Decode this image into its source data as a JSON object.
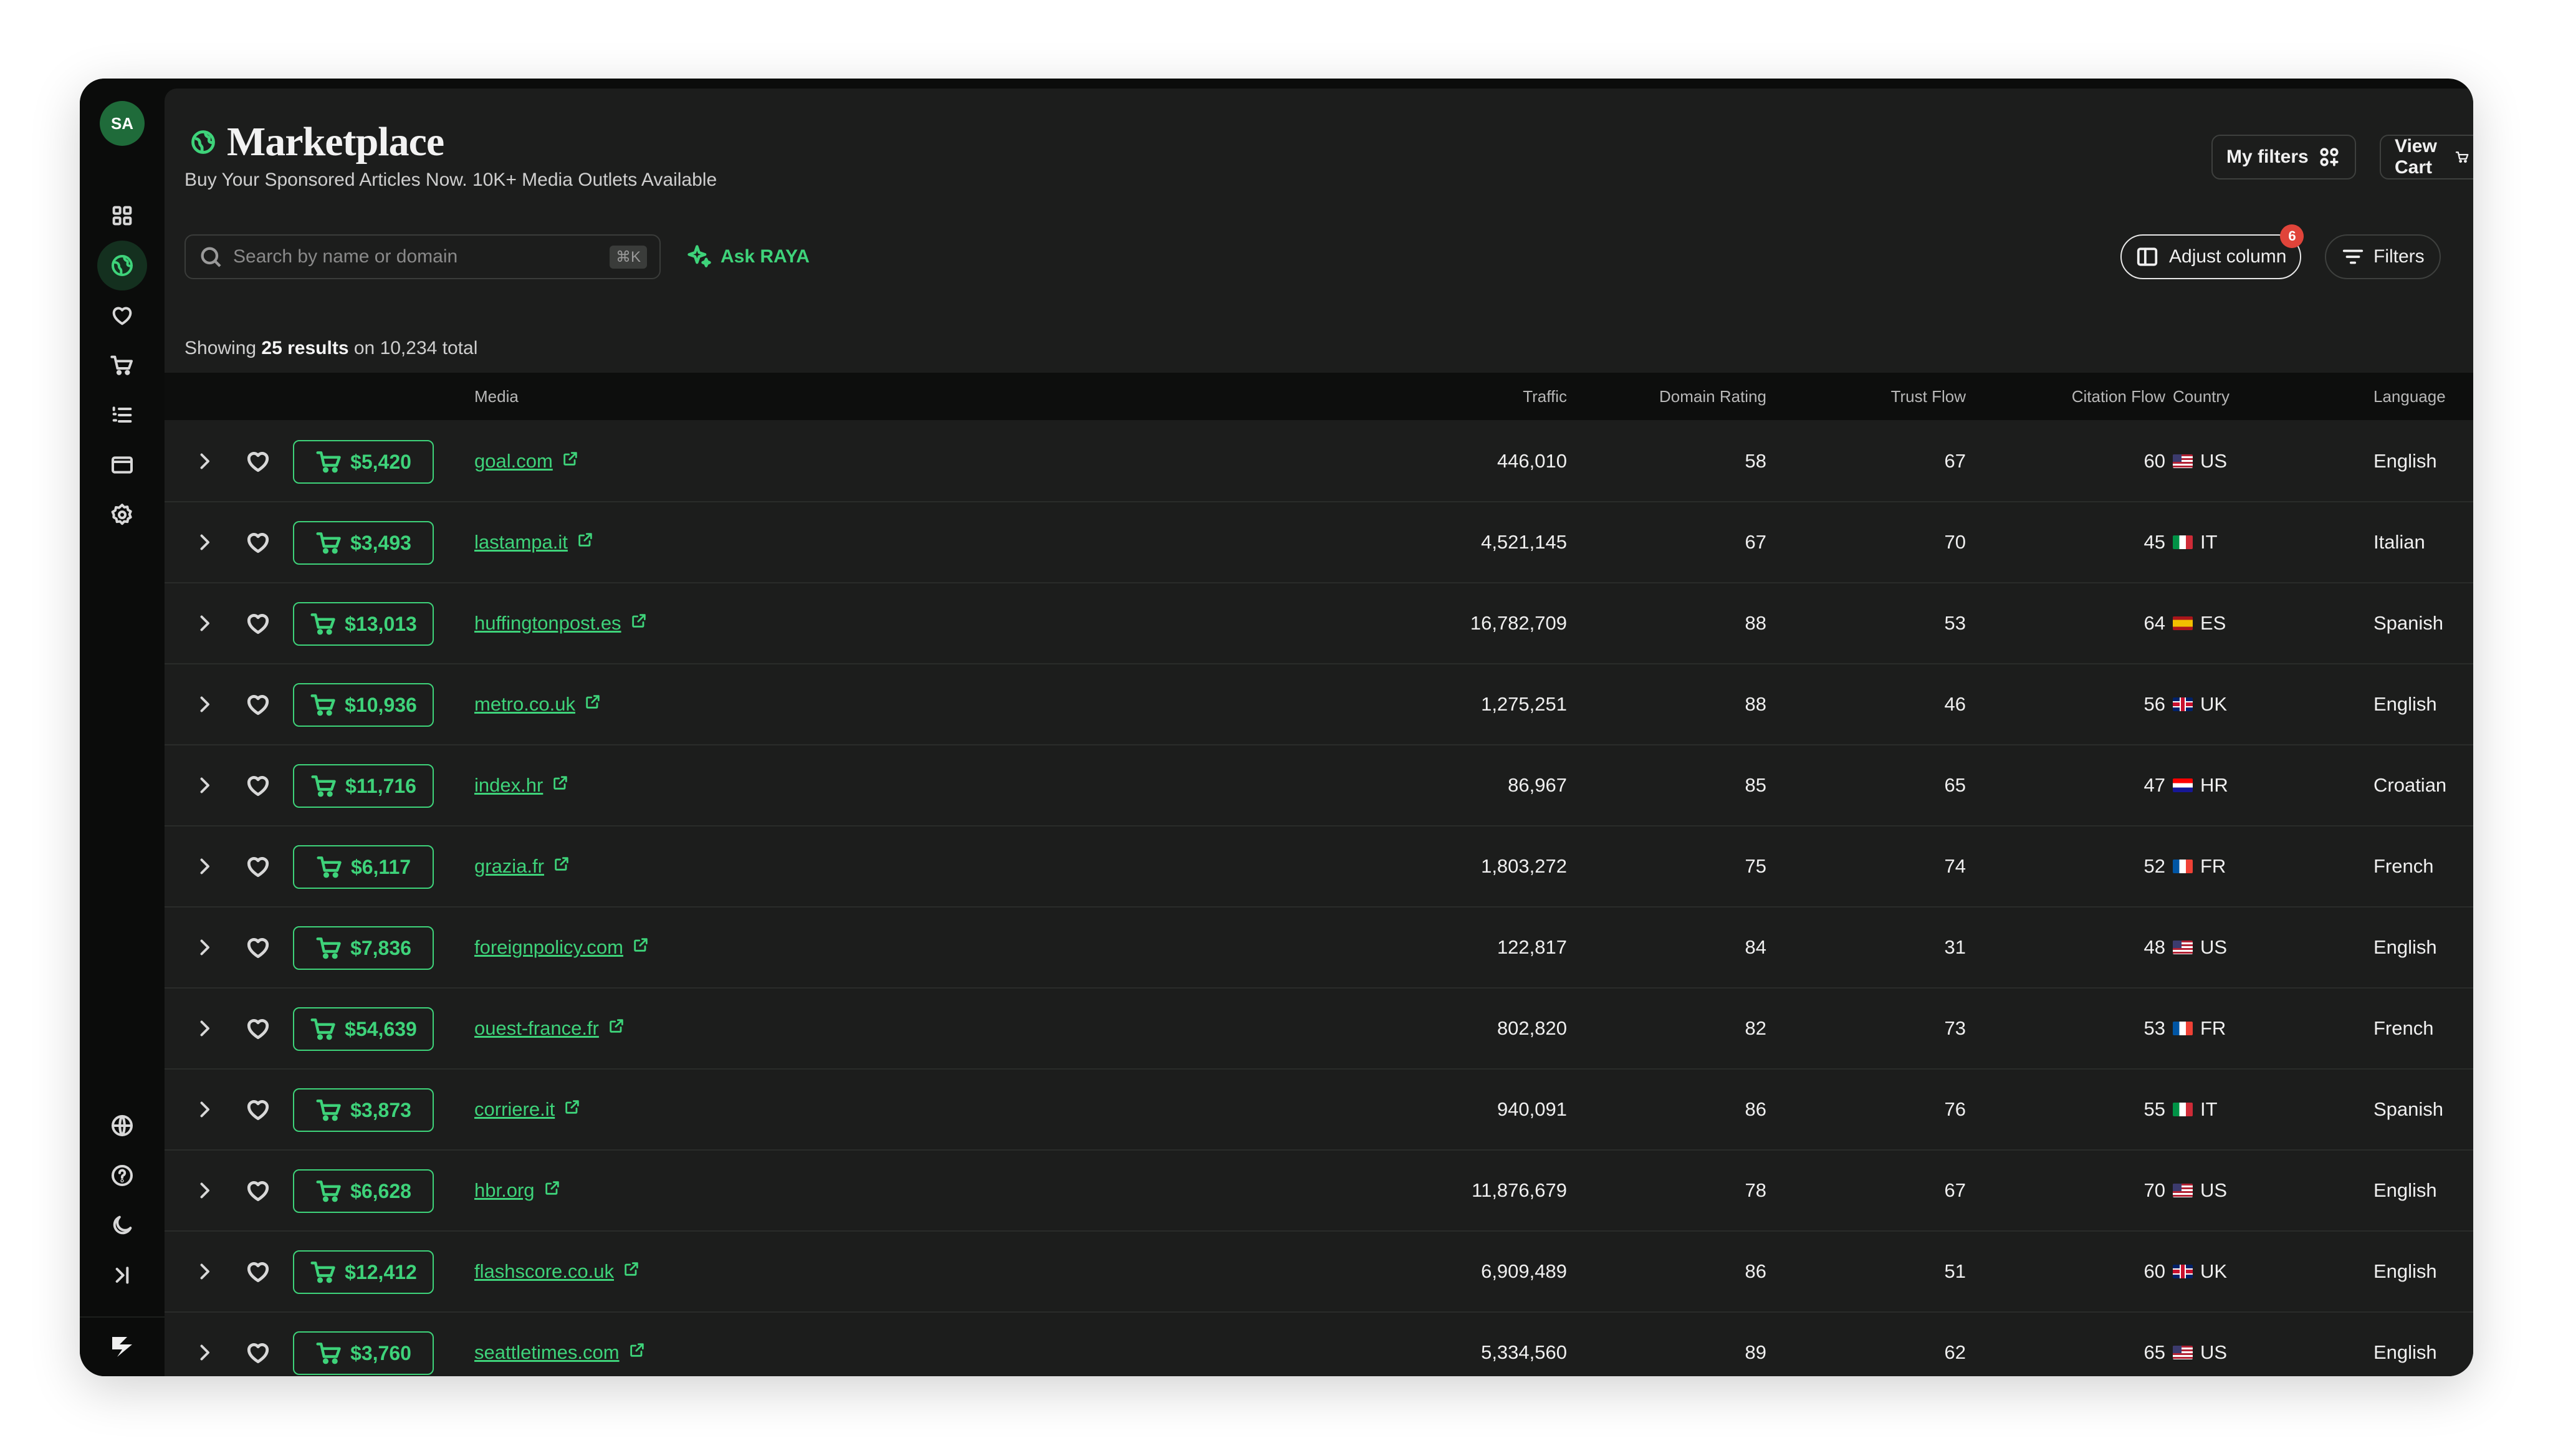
{
  "user": {
    "initials": "SA"
  },
  "sidebar": {
    "items": [
      {
        "icon": "grid-icon"
      },
      {
        "icon": "globe-icon",
        "active": true
      },
      {
        "icon": "heart-icon"
      },
      {
        "icon": "cart-icon"
      },
      {
        "icon": "list-icon"
      },
      {
        "icon": "wallet-icon"
      },
      {
        "icon": "gear-icon"
      }
    ],
    "bottom_items": [
      {
        "icon": "language-icon"
      },
      {
        "icon": "help-icon"
      },
      {
        "icon": "moon-icon"
      },
      {
        "icon": "collapse-icon"
      }
    ]
  },
  "header": {
    "title": "Marketplace",
    "subtitle": "Buy Your Sponsored Articles Now. 10K+ Media Outlets Available",
    "my_filters_label": "My filters",
    "view_cart_label": "View Cart"
  },
  "toolbar": {
    "search_placeholder": "Search by name or domain",
    "search_shortcut": "⌘K",
    "ask_label": "Ask RAYA",
    "adjust_column_label": "Adjust column",
    "adjust_column_badge": "6",
    "filters_label": "Filters"
  },
  "results": {
    "prefix": "Showing",
    "count_label": "25 results",
    "suffix": "on 10,234 total"
  },
  "table": {
    "columns": {
      "media": "Media",
      "traffic": "Traffic",
      "domain_rating": "Domain Rating",
      "trust_flow": "Trust Flow",
      "citation_flow": "Citation Flow",
      "country": "Country",
      "language": "Language"
    },
    "rows": [
      {
        "price": "$5,420",
        "media": "goal.com",
        "traffic": "446,010",
        "dr": "58",
        "tf": "67",
        "cf": "60",
        "country": "US",
        "language": "English"
      },
      {
        "price": "$3,493",
        "media": "lastampa.it",
        "traffic": "4,521,145",
        "dr": "67",
        "tf": "70",
        "cf": "45",
        "country": "IT",
        "language": "Italian"
      },
      {
        "price": "$13,013",
        "media": "huffingtonpost.es",
        "traffic": "16,782,709",
        "dr": "88",
        "tf": "53",
        "cf": "64",
        "country": "ES",
        "language": "Spanish"
      },
      {
        "price": "$10,936",
        "media": "metro.co.uk",
        "traffic": "1,275,251",
        "dr": "88",
        "tf": "46",
        "cf": "56",
        "country": "UK",
        "language": "English"
      },
      {
        "price": "$11,716",
        "media": "index.hr",
        "traffic": "86,967",
        "dr": "85",
        "tf": "65",
        "cf": "47",
        "country": "HR",
        "language": "Croatian"
      },
      {
        "price": "$6,117",
        "media": "grazia.fr",
        "traffic": "1,803,272",
        "dr": "75",
        "tf": "74",
        "cf": "52",
        "country": "FR",
        "language": "French"
      },
      {
        "price": "$7,836",
        "media": "foreignpolicy.com",
        "traffic": "122,817",
        "dr": "84",
        "tf": "31",
        "cf": "48",
        "country": "US",
        "language": "English"
      },
      {
        "price": "$54,639",
        "media": "ouest-france.fr",
        "traffic": "802,820",
        "dr": "82",
        "tf": "73",
        "cf": "53",
        "country": "FR",
        "language": "French"
      },
      {
        "price": "$3,873",
        "media": "corriere.it",
        "traffic": "940,091",
        "dr": "86",
        "tf": "76",
        "cf": "55",
        "country": "IT",
        "language": "Spanish"
      },
      {
        "price": "$6,628",
        "media": "hbr.org",
        "traffic": "11,876,679",
        "dr": "78",
        "tf": "67",
        "cf": "70",
        "country": "US",
        "language": "English"
      },
      {
        "price": "$12,412",
        "media": "flashscore.co.uk",
        "traffic": "6,909,489",
        "dr": "86",
        "tf": "51",
        "cf": "60",
        "country": "UK",
        "language": "English"
      },
      {
        "price": "$3,760",
        "media": "seattletimes.com",
        "traffic": "5,334,560",
        "dr": "89",
        "tf": "62",
        "cf": "65",
        "country": "US",
        "language": "English"
      }
    ]
  },
  "colors": {
    "accent": "#3ed37a",
    "background": "#1c1d1c",
    "sidebar": "#0b0c0b",
    "badge": "#e0443a"
  }
}
